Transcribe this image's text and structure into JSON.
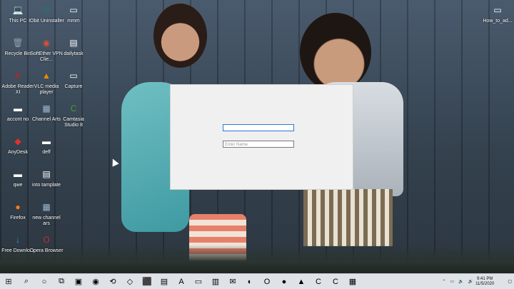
{
  "desktop": {
    "icons": [
      {
        "name": "this-pc",
        "label": "This PC",
        "glyph": "💻",
        "color": "#5aa6e0"
      },
      {
        "name": "iobit-uninstaller",
        "label": "IObit Uninstaller",
        "glyph": "⟲",
        "color": "#1d7a6b"
      },
      {
        "name": "mmm",
        "label": "mmm",
        "glyph": "▭",
        "color": "#ffffff"
      },
      {
        "name": "how-to-ad",
        "label": "How_to_ad...",
        "glyph": "▭",
        "color": "#ffffff"
      },
      {
        "name": "recycle-bin",
        "label": "Recycle Bin",
        "glyph": "🗑",
        "color": "#8fa0b0"
      },
      {
        "name": "softether",
        "label": "SoftEther VPN Clie...",
        "glyph": "◉",
        "color": "#d94f3a"
      },
      {
        "name": "dailytask",
        "label": "dailytask",
        "glyph": "▤",
        "color": "#ffffff"
      },
      {
        "name": "adobe-reader",
        "label": "Adobe Reader XI",
        "glyph": "A",
        "color": "#c8201c"
      },
      {
        "name": "vlc",
        "label": "VLC media player",
        "glyph": "▲",
        "color": "#f08a00"
      },
      {
        "name": "capture",
        "label": "Capture",
        "glyph": "▭",
        "color": "#ffffff"
      },
      {
        "name": "accont-no",
        "label": "accont no",
        "glyph": "▬",
        "color": "#ffffff"
      },
      {
        "name": "channel-arts",
        "label": "Channel Arts",
        "glyph": "▦",
        "color": "#9fb7d0"
      },
      {
        "name": "camtasia",
        "label": "Camtasia Studio 8",
        "glyph": "C",
        "color": "#4e9a2e"
      },
      {
        "name": "anydesk",
        "label": "AnyDesk",
        "glyph": "◆",
        "color": "#e2312b"
      },
      {
        "name": "deff",
        "label": "deff",
        "glyph": "▬",
        "color": "#ffffff"
      },
      {
        "name": "qwe",
        "label": "qwe",
        "glyph": "▬",
        "color": "#ffffff"
      },
      {
        "name": "into-template",
        "label": "into tamplate",
        "glyph": "▤",
        "color": "#ffffff"
      },
      {
        "name": "firefox",
        "label": "Firefox",
        "glyph": "●",
        "color": "#ff7a1a"
      },
      {
        "name": "new-channel-ars",
        "label": "new channel ars",
        "glyph": "▦",
        "color": "#9fb7d0"
      },
      {
        "name": "free-download",
        "label": "Free Downlo...",
        "glyph": "↓",
        "color": "#2aa3d6"
      },
      {
        "name": "opera-browser",
        "label": "Opera Browser",
        "glyph": "O",
        "color": "#d9232d"
      }
    ]
  },
  "dialog": {
    "field1_value": "",
    "field2_placeholder": "Enter Name"
  },
  "taskbar": {
    "start": "⊞",
    "search": "⌕",
    "cortana": "○",
    "taskview": "⧉",
    "apps": [
      "▣",
      "◉",
      "⟲",
      "◇",
      "⬛",
      "▤",
      "A",
      "▭",
      "▥",
      "✉",
      "◐",
      "O",
      "●",
      "▲",
      "C",
      "C",
      "▦"
    ],
    "tray": {
      "chevron": "⌃",
      "network": "▭",
      "volume": "🔈",
      "speaker2": "🔊",
      "time": "9:41 PM",
      "date": "11/5/2020",
      "notif": "▢"
    }
  }
}
